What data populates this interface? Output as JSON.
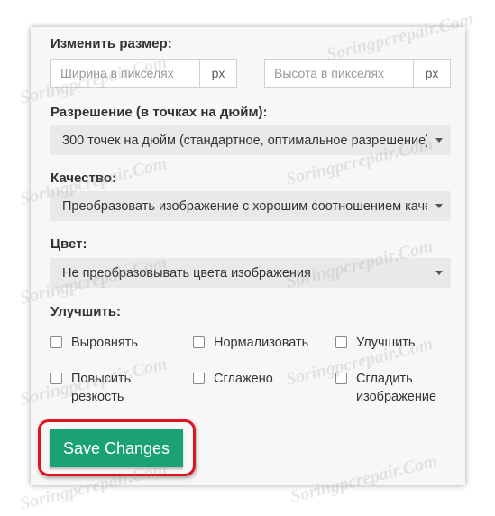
{
  "resize": {
    "label": "Изменить размер:",
    "width_placeholder": "Ширина в пикселях",
    "height_placeholder": "Высота в пикселях",
    "unit": "px"
  },
  "resolution": {
    "label": "Разрешение (в точках на дюйм):",
    "selected": "300 точек на дюйм (стандартное, оптимальное разрешение)"
  },
  "quality": {
    "label": "Качество:",
    "selected": "Преобразовать изображение с хорошим соотношением качества"
  },
  "color": {
    "label": "Цвет:",
    "selected": "Не преобразовывать цвета изображения"
  },
  "enhance": {
    "label": "Улучшить:",
    "options": [
      {
        "label": "Выровнять",
        "checked": false
      },
      {
        "label": "Нормализовать",
        "checked": false
      },
      {
        "label": "Улучшить",
        "checked": false
      },
      {
        "label": "Повысить резкость",
        "checked": false
      },
      {
        "label": "Сглажено",
        "checked": false
      },
      {
        "label": "Сгладить изображение",
        "checked": false
      }
    ]
  },
  "save_label": "Save Changes",
  "watermark": "Soringpcrepair.Com",
  "colors": {
    "button": "#1aa174",
    "highlight": "#e0141b",
    "select_bg": "#e9e9e9"
  }
}
